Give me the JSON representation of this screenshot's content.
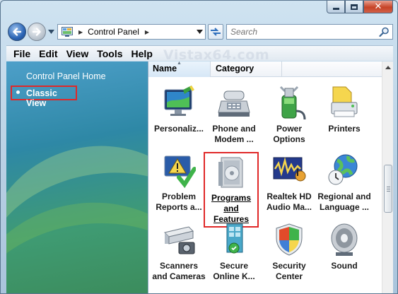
{
  "window": {
    "caption_buttons": [
      "minimize",
      "maximize",
      "close"
    ]
  },
  "navigation": {
    "back_icon": "back-arrow-icon",
    "forward_icon": "forward-arrow-icon",
    "address": {
      "crumb": "Control Panel"
    },
    "search": {
      "placeholder": "Search"
    }
  },
  "menu": {
    "items": [
      "File",
      "Edit",
      "View",
      "Tools",
      "Help"
    ],
    "watermark": "Vistax64.com"
  },
  "left_pane": {
    "home_link": "Control Panel Home",
    "classic_view": "Classic View"
  },
  "columns": {
    "name": "Name",
    "category": "Category"
  },
  "items": [
    {
      "line1": "Personaliz...",
      "line2": "",
      "icon": "personalization-icon"
    },
    {
      "line1": "Phone and",
      "line2": "Modem ...",
      "icon": "phone-modem-icon"
    },
    {
      "line1": "Power",
      "line2": "Options",
      "icon": "power-options-icon"
    },
    {
      "line1": "Printers",
      "line2": "",
      "icon": "printers-icon"
    },
    {
      "line1": "Problem",
      "line2": "Reports a...",
      "icon": "problem-reports-icon"
    },
    {
      "line1": "Programs",
      "line2": "and Features",
      "icon": "programs-features-icon",
      "selected": true
    },
    {
      "line1": "Realtek HD",
      "line2": "Audio Ma...",
      "icon": "realtek-audio-icon"
    },
    {
      "line1": "Regional and",
      "line2": "Language ...",
      "icon": "regional-language-icon"
    },
    {
      "line1": "Scanners",
      "line2": "and Cameras",
      "icon": "scanners-cameras-icon"
    },
    {
      "line1": "Secure",
      "line2": "Online K...",
      "icon": "secure-online-key-icon"
    },
    {
      "line1": "Security",
      "line2": "Center",
      "icon": "security-center-icon"
    },
    {
      "line1": "Sound",
      "line2": "",
      "icon": "sound-icon"
    }
  ],
  "colors": {
    "selection_border": "#e02828",
    "left_pane_top": "#4d9fc9",
    "left_pane_bottom": "#3c8c5c"
  }
}
